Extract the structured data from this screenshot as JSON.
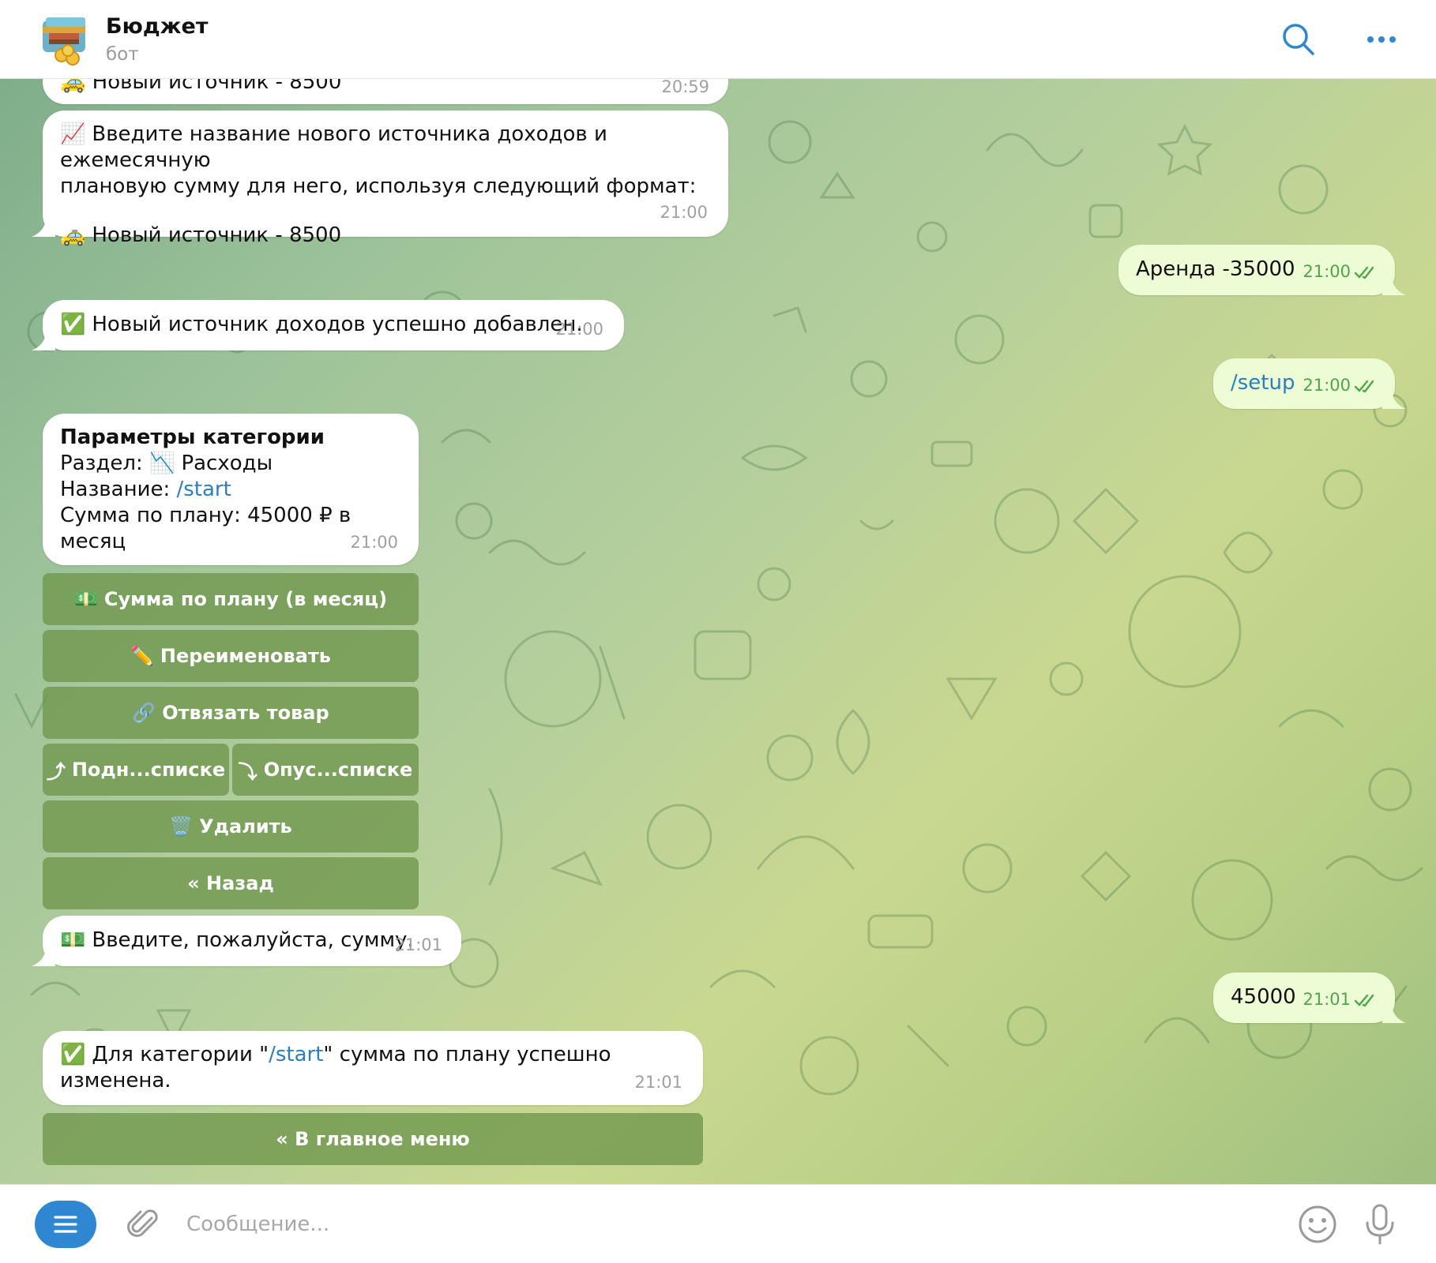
{
  "header": {
    "title": "Бюджет",
    "subtitle": "бот",
    "avatar_icon": "wallet-with-coins-icon"
  },
  "messages": {
    "m0": {
      "text": "🚕 Новый источник - 8500",
      "time": "20:59"
    },
    "m1": {
      "line1": "Введите название нового источника доходов и ежемесячную",
      "line2": "плановую сумму для него, используя следующий формат:",
      "example": "Новый источник - 8500",
      "time": "21:00"
    },
    "m2": {
      "text": "Аренда -35000",
      "time": "21:00"
    },
    "m3": {
      "text": "Новый источник доходов успешно добавлен.",
      "time": "21:00"
    },
    "m4": {
      "text": "/setup",
      "time": "21:00"
    },
    "m5": {
      "title": "Параметры категории",
      "section_label": "Раздел:",
      "section_value": "Расходы",
      "name_label": "Название:",
      "name_value": "/start",
      "sum_text": "Сумма по плану: 45000 ₽ в месяц",
      "time": "21:00"
    },
    "m6": {
      "text": "Введите, пожалуйста, сумму.",
      "time": "21:01"
    },
    "m7": {
      "text": "45000",
      "time": "21:01"
    },
    "m8": {
      "prefix": "Для категории \"",
      "link": "/start",
      "suffix": "\" сумма по плану успешно изменена.",
      "time": "21:01"
    }
  },
  "keyboard": {
    "plan_sum": "Сумма по плану (в месяц)",
    "rename": "Переименовать",
    "unlink": "Отвязать товар",
    "move_up": "Подн...списке",
    "move_down": "Опус...списке",
    "delete": "Удалить",
    "back": "« Назад",
    "main_menu": "« В главное меню"
  },
  "composer": {
    "placeholder": "Сообщение..."
  },
  "colors": {
    "accent": "#2f87d2",
    "outgoing_bubble": "#eefcd6",
    "keyboard_button": "#6e964b",
    "link": "#2a7fc0",
    "outgoing_time": "#4fa64a"
  }
}
